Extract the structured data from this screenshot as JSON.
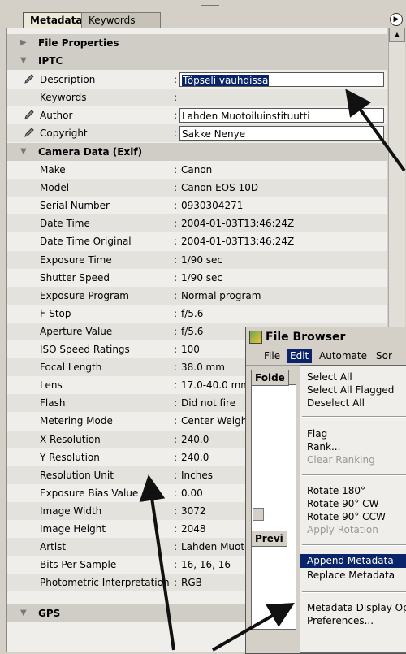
{
  "tabs": {
    "active": "Metadata",
    "inactive": "Keywords"
  },
  "panel_menu_icon": "triangle-menu-icon",
  "sections": {
    "file_properties": "File Properties",
    "iptc": "IPTC",
    "camera": "Camera Data (Exif)",
    "gps": "GPS"
  },
  "iptc": {
    "description": {
      "label": "Description",
      "value": "Töpseli vauhdissa"
    },
    "keywords": {
      "label": "Keywords",
      "value": ""
    },
    "author": {
      "label": "Author",
      "value": "Lahden Muotoiluinstituutti"
    },
    "copyright": {
      "label": "Copyright",
      "value": "Sakke Nenye"
    }
  },
  "exif": [
    {
      "label": "Make",
      "value": "Canon"
    },
    {
      "label": "Model",
      "value": "Canon EOS 10D"
    },
    {
      "label": "Serial Number",
      "value": "0930304271"
    },
    {
      "label": "Date Time",
      "value": "2004-01-03T13:46:24Z"
    },
    {
      "label": "Date Time Original",
      "value": "2004-01-03T13:46:24Z"
    },
    {
      "label": "Exposure Time",
      "value": "1/90 sec"
    },
    {
      "label": "Shutter Speed",
      "value": "1/90 sec"
    },
    {
      "label": "Exposure Program",
      "value": "Normal program"
    },
    {
      "label": "F-Stop",
      "value": "f/5.6"
    },
    {
      "label": "Aperture Value",
      "value": "f/5.6"
    },
    {
      "label": "ISO Speed Ratings",
      "value": "100"
    },
    {
      "label": "Focal Length",
      "value": "38.0 mm"
    },
    {
      "label": "Lens",
      "value": "17.0-40.0 mm"
    },
    {
      "label": "Flash",
      "value": "Did not fire"
    },
    {
      "label": "Metering Mode",
      "value": "Center Weight"
    },
    {
      "label": "X Resolution",
      "value": "240.0"
    },
    {
      "label": "Y Resolution",
      "value": "240.0"
    },
    {
      "label": "Resolution Unit",
      "value": "Inches"
    },
    {
      "label": "Exposure Bias Value",
      "value": "0.00"
    },
    {
      "label": "Image Width",
      "value": "3072"
    },
    {
      "label": "Image Height",
      "value": "2048"
    },
    {
      "label": "Artist",
      "value": "Lahden Muotoiluinstituutti"
    },
    {
      "label": "Bits Per Sample",
      "value": "16, 16, 16"
    },
    {
      "label": "Photometric Interpretation",
      "value": "RGB"
    }
  ],
  "file_browser": {
    "title": "File Browser",
    "menus": [
      "File",
      "Edit",
      "Automate",
      "Sor"
    ],
    "folders_tab": "Folde",
    "preview_tab": "Previ",
    "edit_menu": {
      "g1": [
        "Select All",
        "Select All Flagged",
        "Deselect All"
      ],
      "g2": [
        "Flag",
        "Rank...",
        "Clear Ranking"
      ],
      "g3": [
        "Rotate 180°",
        "Rotate 90° CW",
        "Rotate 90° CCW",
        "Apply Rotation"
      ],
      "g4": [
        "Append Metadata",
        "Replace Metadata"
      ],
      "g5": [
        "Metadata Display Op",
        "Preferences..."
      ]
    }
  }
}
